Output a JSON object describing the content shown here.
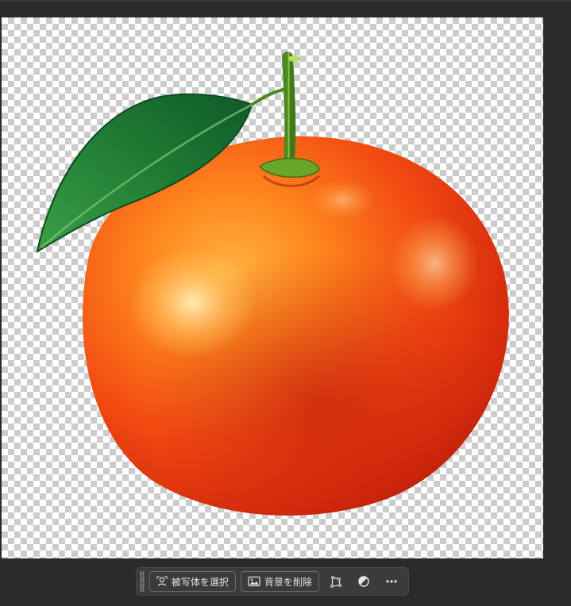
{
  "canvas": {
    "content": "tangerine-illustration-on-transparent-background",
    "colors": {
      "fruit": "#f05a17",
      "leaf": "#2a8a3a",
      "stem": "#5a9a2a"
    }
  },
  "taskbar": {
    "select_subject_label": "被写体を選択",
    "remove_background_label": "背景を削除",
    "icons": [
      "person-select-icon",
      "image-icon",
      "transform-icon",
      "adjust-icon",
      "more-icon"
    ]
  },
  "colors": {
    "app_bg": "#2a2a2a",
    "bar_bg": "#3b3b3b",
    "text": "#e6e6e6"
  }
}
